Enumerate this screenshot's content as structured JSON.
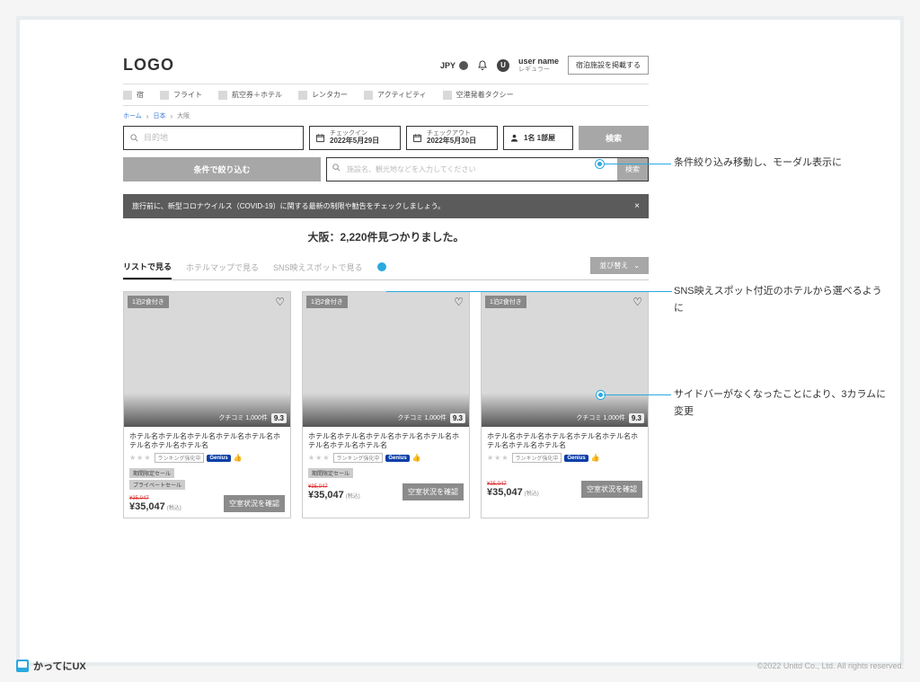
{
  "header": {
    "logo": "LOGO",
    "currency": "JPY",
    "user_name": "user name",
    "user_tier": "レギュラー",
    "list_property": "宿泊施設を掲載する"
  },
  "nav": {
    "items": [
      "宿",
      "フライト",
      "航空券＋ホテル",
      "レンタカー",
      "アクティビティ",
      "空港発着タクシー"
    ]
  },
  "breadcrumb": [
    "ホーム",
    "日本",
    "大阪"
  ],
  "search": {
    "dest_placeholder": "目的地",
    "checkin_label": "チェックイン",
    "checkin_value": "2022年5月29日",
    "checkout_label": "チェックアウト",
    "checkout_value": "2022年5月30日",
    "guests": "1名 1部屋",
    "button": "検索",
    "filter_button": "条件で絞り込む",
    "keyword_placeholder": "施設名、観光地などを入力してください",
    "keyword_button": "検索"
  },
  "banner": {
    "text": "旅行前に、新型コロナウイルス（COVID-19）に関する最新の制限や勧告をチェックしましょう。"
  },
  "results": {
    "heading": "大阪：2,220件見つかりました。",
    "tabs": [
      "リストで見る",
      "ホテルマップで見る",
      "SNS映えスポットで見る"
    ],
    "sort": "並び替え"
  },
  "card": {
    "meal_tag": "1泊2食付き",
    "review_count": "クチコミ 1,000件",
    "score": "9.3",
    "hotel_name": "ホテル名ホテル名ホテル名ホテル名ホテル名ホテル名ホテル名ホテル名",
    "rank_tag": "ランキング強化中",
    "genius": "Genius",
    "sale1": "期間限定セール",
    "sale2": "プライベートセール",
    "strike_price": "¥35,047",
    "price": "¥35,047",
    "tax": "(税込)",
    "avail_btn": "空室状況を確認"
  },
  "annotations": {
    "a1": "条件絞り込み移動し、モーダル表示に",
    "a2": "SNS映えスポット付近のホテルから選べるように",
    "a3": "サイドバーがなくなったことにより、3カラムに変更"
  },
  "footer": {
    "brand": "かってにUX",
    "copy": "©2022 Unitd Co., Ltd. All rights reserved."
  }
}
